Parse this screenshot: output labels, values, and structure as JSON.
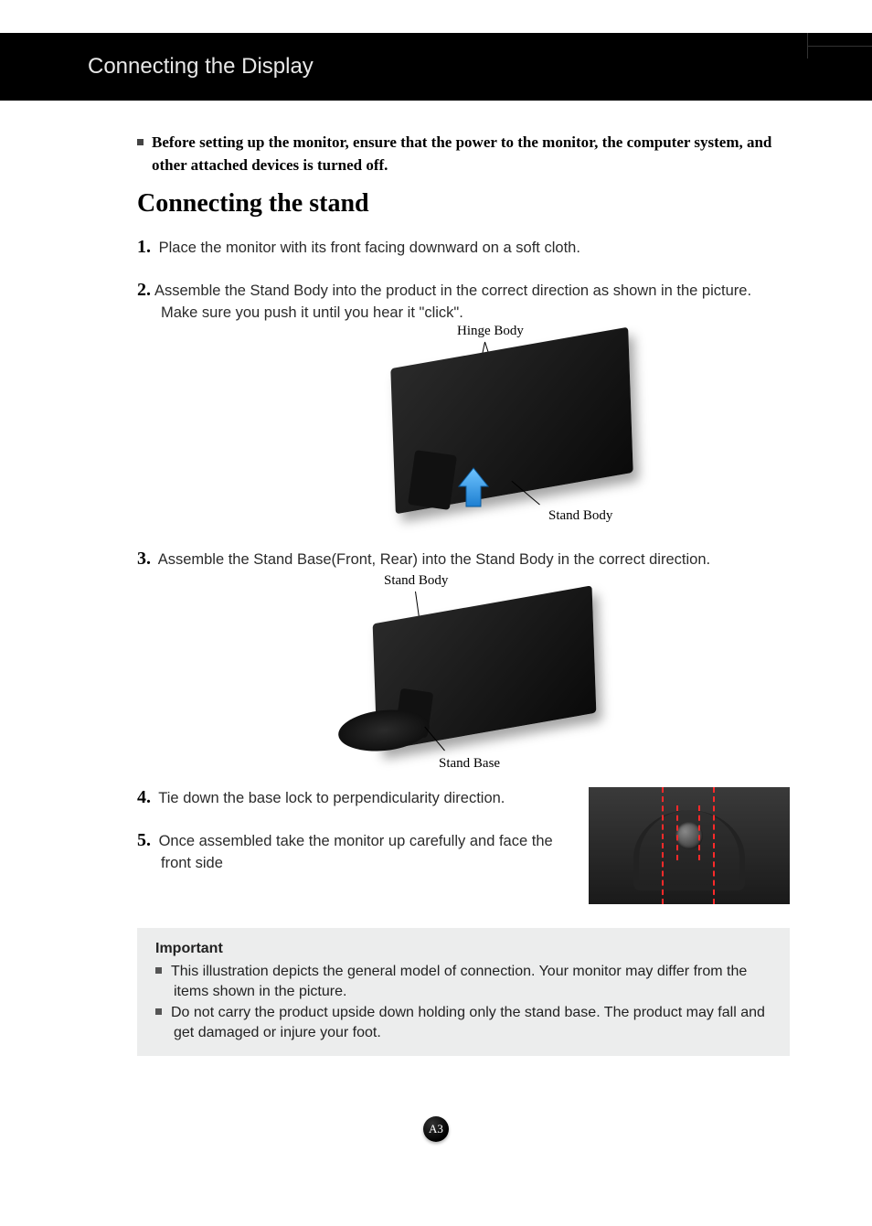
{
  "header": {
    "title": "Connecting the Display"
  },
  "intro": "Before setting up the monitor, ensure that the power to the monitor, the computer system, and other attached devices is turned off.",
  "section_title": "Connecting the stand",
  "steps": {
    "s1": {
      "num": "1.",
      "text": "Place the monitor with its front facing downward on a soft cloth."
    },
    "s2": {
      "num": "2.",
      "text": "Assemble the Stand Body into the product in the correct direction as shown in the picture.",
      "text2": "Make sure you push it until you hear it \"click\"."
    },
    "s3": {
      "num": "3.",
      "text": "Assemble the Stand Base(Front, Rear) into the Stand Body in the correct direction."
    },
    "s4": {
      "num": "4.",
      "text": "Tie down the base lock to perpendicularity direction."
    },
    "s5": {
      "num": "5.",
      "text": "Once assembled take the monitor up carefully and face the front side"
    }
  },
  "figure1": {
    "label_top": "Hinge Body",
    "label_bottom": "Stand Body"
  },
  "figure2": {
    "label_top": "Stand Body",
    "label_bottom": "Stand Base"
  },
  "important": {
    "title": "Important",
    "items": [
      "This illustration depicts the general model of connection. Your monitor may differ from the items shown in the picture.",
      "Do not carry the product upside down holding only the stand base. The product may fall and get damaged or injure your foot."
    ]
  },
  "page_number": "A3"
}
